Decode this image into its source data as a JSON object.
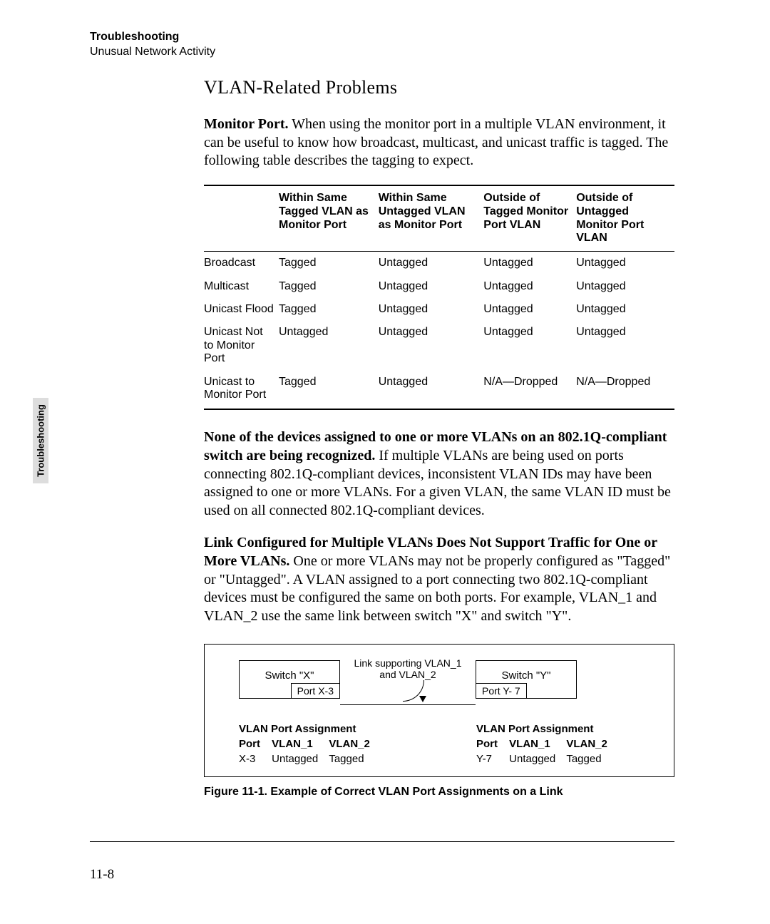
{
  "header": {
    "chapter": "Troubleshooting",
    "section": "Unusual Network Activity"
  },
  "side_tab": "Troubleshooting",
  "title": "VLAN-Related Problems",
  "para1": {
    "lead": "Monitor Port.",
    "body": "  When using the monitor port in a multiple VLAN environment, it can be useful to know how broadcast, multicast, and unicast traffic is tagged. The following table describes the tagging to expect."
  },
  "table": {
    "headers": [
      "",
      "Within Same Tagged VLAN as Monitor Port",
      "Within Same Untagged VLAN as Monitor Port",
      "Outside of Tagged Monitor Port VLAN",
      "Outside of Untagged Monitor Port VLAN"
    ],
    "rows": [
      [
        "Broadcast",
        "Tagged",
        "Untagged",
        "Untagged",
        "Untagged"
      ],
      [
        "Multicast",
        "Tagged",
        "Untagged",
        "Untagged",
        "Untagged"
      ],
      [
        "Unicast Flood",
        "Tagged",
        "Untagged",
        "Untagged",
        "Untagged"
      ],
      [
        "Unicast Not to Monitor Port",
        "Untagged",
        "Untagged",
        "Untagged",
        "Untagged"
      ],
      [
        "Unicast to Monitor Port",
        "Tagged",
        "Untagged",
        "N/A—Dropped",
        "N/A—Dropped"
      ]
    ]
  },
  "para2": {
    "lead": "None of the devices assigned to one or more VLANs on an 802.1Q-compliant switch are being recognized.",
    "body": "   If multiple VLANs are being used on ports connecting 802.1Q-compliant devices, inconsistent VLAN IDs may have been assigned to one or more VLANs. For a given VLAN, the same VLAN ID must be used on all connected 802.1Q-compliant devices."
  },
  "para3": {
    "lead": "Link Configured for Multiple VLANs Does Not Support Traffic for One or More VLANs.",
    "body": "   One or more VLANs may not be properly configured as \"Tagged\" or \"Untagged\". A VLAN assigned to a port connecting two 802.1Q-compliant devices must be configured the same on both ports. For example, VLAN_1 and VLAN_2 use the same link between switch \"X\" and switch \"Y\"."
  },
  "figure": {
    "switch_x": {
      "name": "Switch \"X\"",
      "port": "Port X-3"
    },
    "switch_y": {
      "name": "Switch \"Y\"",
      "port": "Port Y- 7"
    },
    "link_label_l1": "Link supporting VLAN_1",
    "link_label_l2": "and VLAN_2",
    "assign_title": "VLAN Port Assignment",
    "hdr_port": "Port",
    "hdr_v1": "VLAN_1",
    "hdr_v2": "VLAN_2",
    "left": {
      "port": "X-3",
      "v1": "Untagged",
      "v2": "Tagged"
    },
    "right": {
      "port": "Y-7",
      "v1": "Untagged",
      "v2": "Tagged"
    },
    "caption": "Figure 11-1.  Example of Correct VLAN Port Assignments on a Link"
  },
  "page_number": "11-8"
}
